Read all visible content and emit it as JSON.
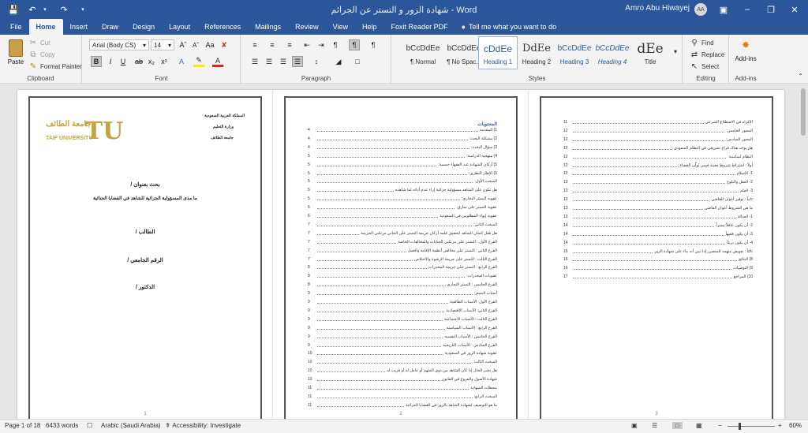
{
  "titlebar": {
    "title": "شهادة الزور و التستر عن الجرائم  -  Word",
    "user": "Amro Abu Hiwayej",
    "initials": "AA"
  },
  "tabs": [
    "File",
    "Home",
    "Insert",
    "Draw",
    "Design",
    "Layout",
    "References",
    "Mailings",
    "Review",
    "View",
    "Help",
    "Foxit Reader PDF"
  ],
  "tellme": "Tell me what you want to do",
  "clipboard": {
    "paste": "Paste",
    "cut": "Cut",
    "copy": "Copy",
    "format_painter": "Format Painter",
    "label": "Clipboard"
  },
  "font": {
    "name": "Arial (Body CS)",
    "size": "14",
    "label": "Font"
  },
  "paragraph": {
    "label": "Paragraph"
  },
  "styles": {
    "label": "Styles",
    "items": [
      {
        "preview": "‫bCcDdEe",
        "name": "¶ Normal"
      },
      {
        "preview": "‫bCcDdEe",
        "name": "¶ No Spac..."
      },
      {
        "preview": "cDdEe",
        "name": "Heading 1"
      },
      {
        "preview": "DdEe",
        "name": "Heading 2"
      },
      {
        "preview": "‫bCcDdEe",
        "name": "Heading 3"
      },
      {
        "preview": "‫bCcDdEe",
        "name": "Heading 4"
      },
      {
        "preview": "dEe",
        "name": "Title"
      }
    ]
  },
  "editing": {
    "find": "Find",
    "replace": "Replace",
    "select": "Select",
    "label": "Editing"
  },
  "addins": {
    "button": "Add-ins",
    "label": "Add-ins"
  },
  "page1": {
    "kingdom": "المملكة العربية السعودية",
    "ministry": "وزارة التعليم",
    "university": "جامعة الطائف",
    "logo_ar": "جامعة الطائف",
    "logo_en": "TAIF UNIVERSITY",
    "logo_mark": "TU",
    "research": "بحث بعنوان /",
    "topic": "ما مدى المسؤولية الجزائية للشاهد في القضايا الجنائية",
    "student": "الطالب /",
    "id": "الرقم الجامعي /",
    "doctor": "الدكتور /",
    "number": "1"
  },
  "page2": {
    "heading": "المحتويات",
    "number": "2",
    "toc": [
      {
        "t": "1) المقدمة",
        "n": "4"
      },
      {
        "t": "2) مشكلة البحث:",
        "n": "4"
      },
      {
        "t": "3) سؤال البحث:",
        "n": "4"
      },
      {
        "t": "4) منهجية الدراسة:",
        "n": "5"
      },
      {
        "t": "5) أركان الشهادة عند الفقهاء خمسة:",
        "n": "5"
      },
      {
        "t": "6) الإطار النظري:",
        "n": "5"
      },
      {
        "t": "المبحث الأول:",
        "n": "5"
      },
      {
        "t": "هل تكون على الشاهد مسؤولية جزائية إزاء عدم أدائه لما شاهده",
        "n": "5"
      },
      {
        "t": "عقوبة التستر التجاري:",
        "n": "5"
      },
      {
        "t": "عقوبة التستر على سارق:",
        "n": "6"
      },
      {
        "t": "عقوبة إيواء المطلوبين في السعودية",
        "n": "6"
      },
      {
        "t": "المبحث الثاني:",
        "n": "7"
      },
      {
        "t": "هل فعل كتمان الشاهد لتحقيق علمه أركان جريمة التستر على الجاني مرتكبي الجريمة",
        "n": "7"
      },
      {
        "t": "الفرع الأول : التستر على مرتكبي الجنايات والمخالفات الخاصة",
        "n": "7"
      },
      {
        "t": "الفرع الثاني : التستر على مخالفي أنظمة الإقامة والعمل",
        "n": "7"
      },
      {
        "t": "الفرع الثالث : التستر على جريمة الرشوة والاختلاس",
        "n": "7"
      },
      {
        "t": "الفرع الرابع : التستر على جريمة المخدرات",
        "n": "8"
      },
      {
        "t": "عقوبات المخدرات:",
        "n": "8"
      },
      {
        "t": "الفرع الخامس : التستر التجاري",
        "n": "8"
      },
      {
        "t": "أسباب التستر:",
        "n": "9"
      },
      {
        "t": "الفرع الأول: الأسباب الطائفية",
        "n": "9"
      },
      {
        "t": "الفرع الثاني: الأسباب الاقتصادية",
        "n": "9"
      },
      {
        "t": "الفرع الثالث : الأسباب الاجتماعية",
        "n": "9"
      },
      {
        "t": "الفرع الرابع : الأسباب السياسية",
        "n": "9"
      },
      {
        "t": "الفرع الخامس : الأسباب النفسية",
        "n": "9"
      },
      {
        "t": "الفرع السادس : الأسباب التاريخية",
        "n": "9"
      },
      {
        "t": "عقوبة شهادة الزور في السعودية",
        "n": "10"
      },
      {
        "t": "المبحث الثالث:",
        "n": "10"
      },
      {
        "t": "هل يعتبر الحال إذا كان الشاهد من ذوي المتهم أو عامل له أو قريب له",
        "n": "10"
      },
      {
        "t": "شهادة الأصول والفروع في القانون",
        "n": "10"
      },
      {
        "t": "محظات الشهادة",
        "n": "11"
      },
      {
        "t": "المبحث الرابع:",
        "n": "11"
      },
      {
        "t": "ما هو التوصيف لشهادة الشاهد بالزور في القضايا الجزائية",
        "n": "11"
      }
    ]
  },
  "page3": {
    "number": "3",
    "toc": [
      {
        "t": "الإكراه في الاصطلاح الشرعي",
        "n": "11"
      },
      {
        "t": "المحور الخامس:",
        "n": "12"
      },
      {
        "t": "المحور السادس:",
        "n": "12"
      },
      {
        "t": "هل يوجد هناك فراغ تشريعي في النظام السعودي",
        "n": "12"
      },
      {
        "t": "النظام لمناسبة:",
        "n": "12"
      },
      {
        "t": "أولاً : اشتراط شروط معينة فيمن يُولَّى القضاء",
        "n": "12"
      },
      {
        "t": "1- الإسلام",
        "n": "12"
      },
      {
        "t": "2- العقل والبلوغ",
        "n": "13"
      },
      {
        "t": "3- العلم",
        "n": "13"
      },
      {
        "t": "ثانياً : توفير أعوان للقاضي",
        "n": "13"
      },
      {
        "t": "ما هي الشروط أعوان القاضي",
        "n": "13"
      },
      {
        "t": "1- العدالة",
        "n": "13"
      },
      {
        "t": "2- أن يكون عاقلاً مميزاً",
        "n": "14"
      },
      {
        "t": "3- أن يكون فقيهاً",
        "n": "14"
      },
      {
        "t": "4- أن يكون بريئاً",
        "n": "14"
      },
      {
        "t": "ثالثاً : تعويض متهمه للمتضرر إذا تبين أنه بناء على شهادة الزور",
        "n": "15"
      },
      {
        "t": "8) النتائج",
        "n": "16"
      },
      {
        "t": "9) التوصيات",
        "n": "16"
      },
      {
        "t": "10) المراجع",
        "n": "17"
      }
    ]
  },
  "status": {
    "page": "Page 1 of 18",
    "words": "6433 words",
    "language": "Arabic (Saudi Arabia)",
    "accessibility": "Accessibility: Investigate",
    "zoom": "60%"
  }
}
